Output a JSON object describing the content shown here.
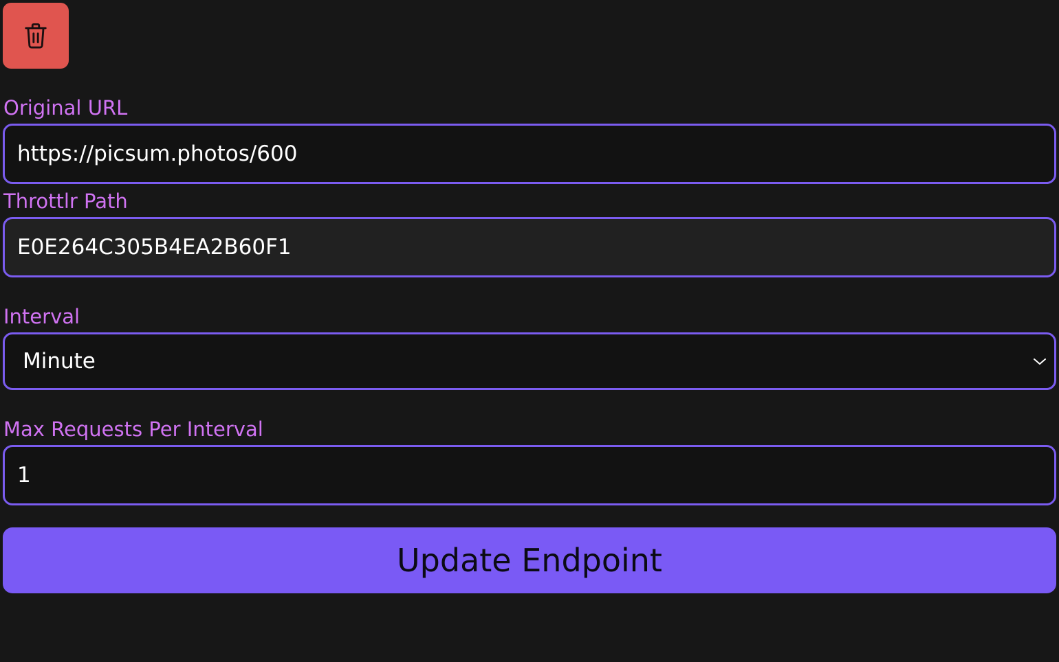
{
  "actions": {
    "delete_icon": "trash-icon",
    "update_label": "Update Endpoint"
  },
  "form": {
    "original_url": {
      "label": "Original URL",
      "value": "https://picsum.photos/600"
    },
    "throttlr_path": {
      "label": "Throttlr Path",
      "value": "E0E264C305B4EA2B60F1"
    },
    "interval": {
      "label": "Interval",
      "selected": "Minute"
    },
    "max_requests": {
      "label": "Max Requests Per Interval",
      "value": "1"
    }
  },
  "colors": {
    "background": "#171717",
    "accent": "#7b5cf0",
    "label": "#d073f2",
    "danger": "#e0554f"
  }
}
